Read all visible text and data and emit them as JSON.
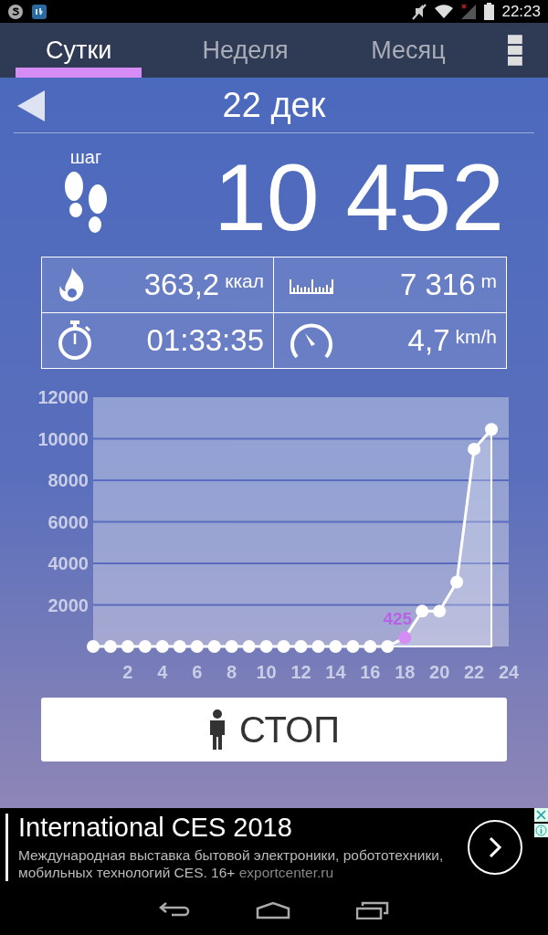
{
  "status_bar": {
    "time": "22:23"
  },
  "tabs": [
    {
      "label": "Сутки",
      "selected": true
    },
    {
      "label": "Неделя",
      "selected": false
    },
    {
      "label": "Месяц",
      "selected": false
    }
  ],
  "date": "22 дек",
  "steps": {
    "label": "шаг",
    "value": "10 452"
  },
  "stats": [
    {
      "kind": "calories",
      "value": "363,2",
      "unit": "ккал"
    },
    {
      "kind": "distance",
      "value": "7 316",
      "unit": "m"
    },
    {
      "kind": "time",
      "value": "01:33:35"
    },
    {
      "kind": "speed",
      "value": "4,7",
      "unit": "km/h"
    }
  ],
  "chart_data": {
    "type": "area",
    "x": [
      0,
      1,
      2,
      3,
      4,
      5,
      6,
      7,
      8,
      9,
      10,
      11,
      12,
      13,
      14,
      15,
      16,
      17,
      18,
      19,
      20,
      21,
      22,
      23
    ],
    "series": [
      {
        "color": "#ffffff",
        "values": [
          0,
          0,
          0,
          0,
          0,
          0,
          0,
          0,
          0,
          0,
          0,
          0,
          0,
          0,
          0,
          0,
          0,
          0,
          425,
          1700,
          1700,
          3100,
          9500,
          10452
        ]
      }
    ],
    "xlim": [
      0,
      24
    ],
    "ylim": [
      0,
      12000
    ],
    "xticks": [
      2,
      4,
      6,
      8,
      10,
      12,
      14,
      16,
      18,
      20,
      22,
      24
    ],
    "yticks": [
      2000,
      4000,
      6000,
      8000,
      10000,
      12000
    ],
    "grid": true,
    "value_labels": [
      null,
      null,
      null,
      null,
      null,
      null,
      null,
      null,
      null,
      null,
      null,
      null,
      null,
      null,
      null,
      null,
      null,
      null,
      "425",
      null,
      null,
      null,
      null,
      null
    ]
  },
  "stop_button": {
    "label": "СТОП"
  },
  "ad": {
    "title": "International CES 2018",
    "text": "Международная выставка бытовой электроники, робототехники, мобильных технологий CES. 16+",
    "link": "exportcenter.ru"
  }
}
